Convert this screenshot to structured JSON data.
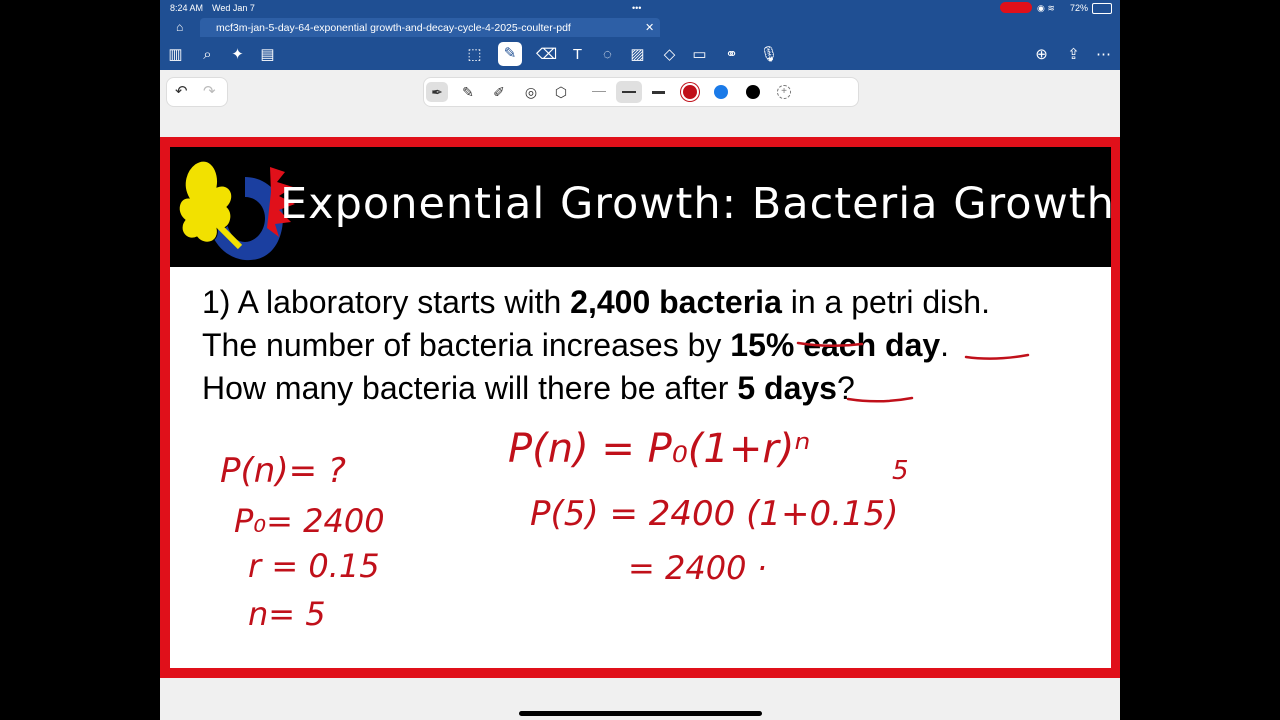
{
  "status": {
    "time": "8:24 AM",
    "date": "Wed Jan 7",
    "battery": "72%"
  },
  "document": {
    "tab_title": "mcf3m-jan-5-day-64-exponential growth-and-decay-cycle-4-2025-coulter-pdf"
  },
  "slide": {
    "title": "Exponential Growth: Bacteria Growth",
    "problem": {
      "line1_a": "1) A laboratory starts with ",
      "line1_b": "2,400 bacteria",
      "line1_c": " in a petri dish.",
      "line2_a": "The number of bacteria increases by ",
      "line2_b": "15%",
      "line2_c": " ",
      "line2_d": "each day",
      "line2_e": ".",
      "line3_a": "How many bacteria will there be after ",
      "line3_b": "5 days",
      "line3_c": "?"
    }
  },
  "handwriting": {
    "given": [
      "P(n)= ?",
      "P₀= 2400",
      "r = 0.15",
      "n= 5"
    ],
    "formula": "P(n) = P₀(1+r)ⁿ",
    "step1_left": "P(5) = 2400 (1+0.15)",
    "step1_exp": "5",
    "step2": "= 2400 ·"
  },
  "colors": {
    "ink": "#c0101a",
    "frame": "#e0101a",
    "bar": "#1f4f93"
  }
}
